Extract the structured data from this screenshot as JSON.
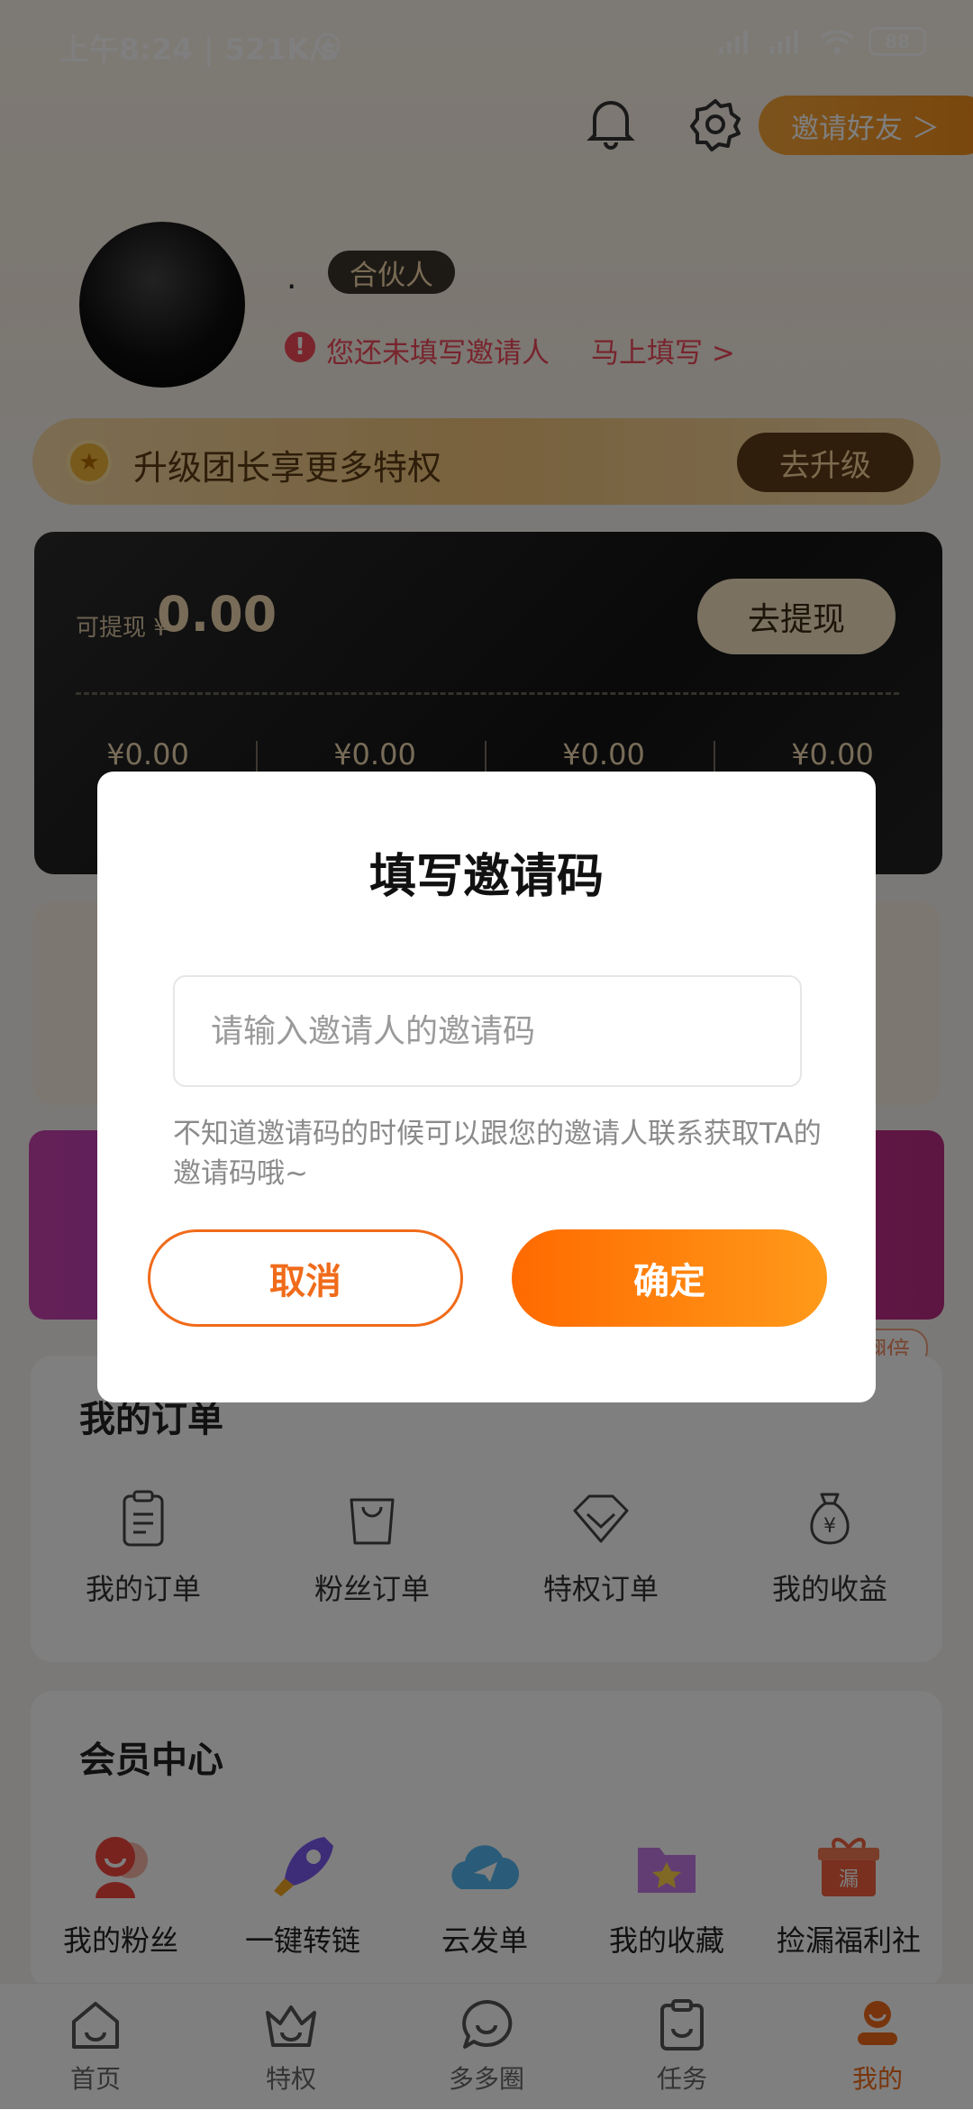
{
  "status_bar": {
    "time": "上午8:24 | 521K/s",
    "battery": "88"
  },
  "header": {
    "invite_label": "邀请好友 ＞"
  },
  "profile": {
    "nickname": ".",
    "role_tag": "合伙人",
    "warning_text": "您还未填写邀请人",
    "warning_link": "马上填写 >"
  },
  "upgrade": {
    "text": "升级团长享更多特权",
    "button": "去升级"
  },
  "wallet": {
    "label": "可提现 ¥",
    "amount": "0.00",
    "withdraw_button": "去提现",
    "stats": [
      "¥0.00",
      "¥0.00",
      "¥0.00",
      "¥0.00"
    ]
  },
  "promo": {
    "badge": "力翻倍"
  },
  "orders": {
    "title": "我的订单",
    "items": [
      "我的订单",
      "粉丝订单",
      "特权订单",
      "我的收益"
    ]
  },
  "member": {
    "title": "会员中心",
    "items": [
      "我的粉丝",
      "一键转链",
      "云发单",
      "我的收藏",
      "捡漏福利社"
    ]
  },
  "bottom_nav": {
    "items": [
      "首页",
      "特权",
      "多多圈",
      "任务",
      "我的"
    ]
  },
  "dialog": {
    "title": "填写邀请码",
    "placeholder": "请输入邀请人的邀请码",
    "hint": "不知道邀请码的时候可以跟您的邀请人联系获取TA的邀请码哦~",
    "cancel": "取消",
    "confirm": "确定"
  },
  "colors": {
    "accent": "#f06b1a",
    "warning": "#f0495a",
    "gold": "#f1d9b1"
  }
}
